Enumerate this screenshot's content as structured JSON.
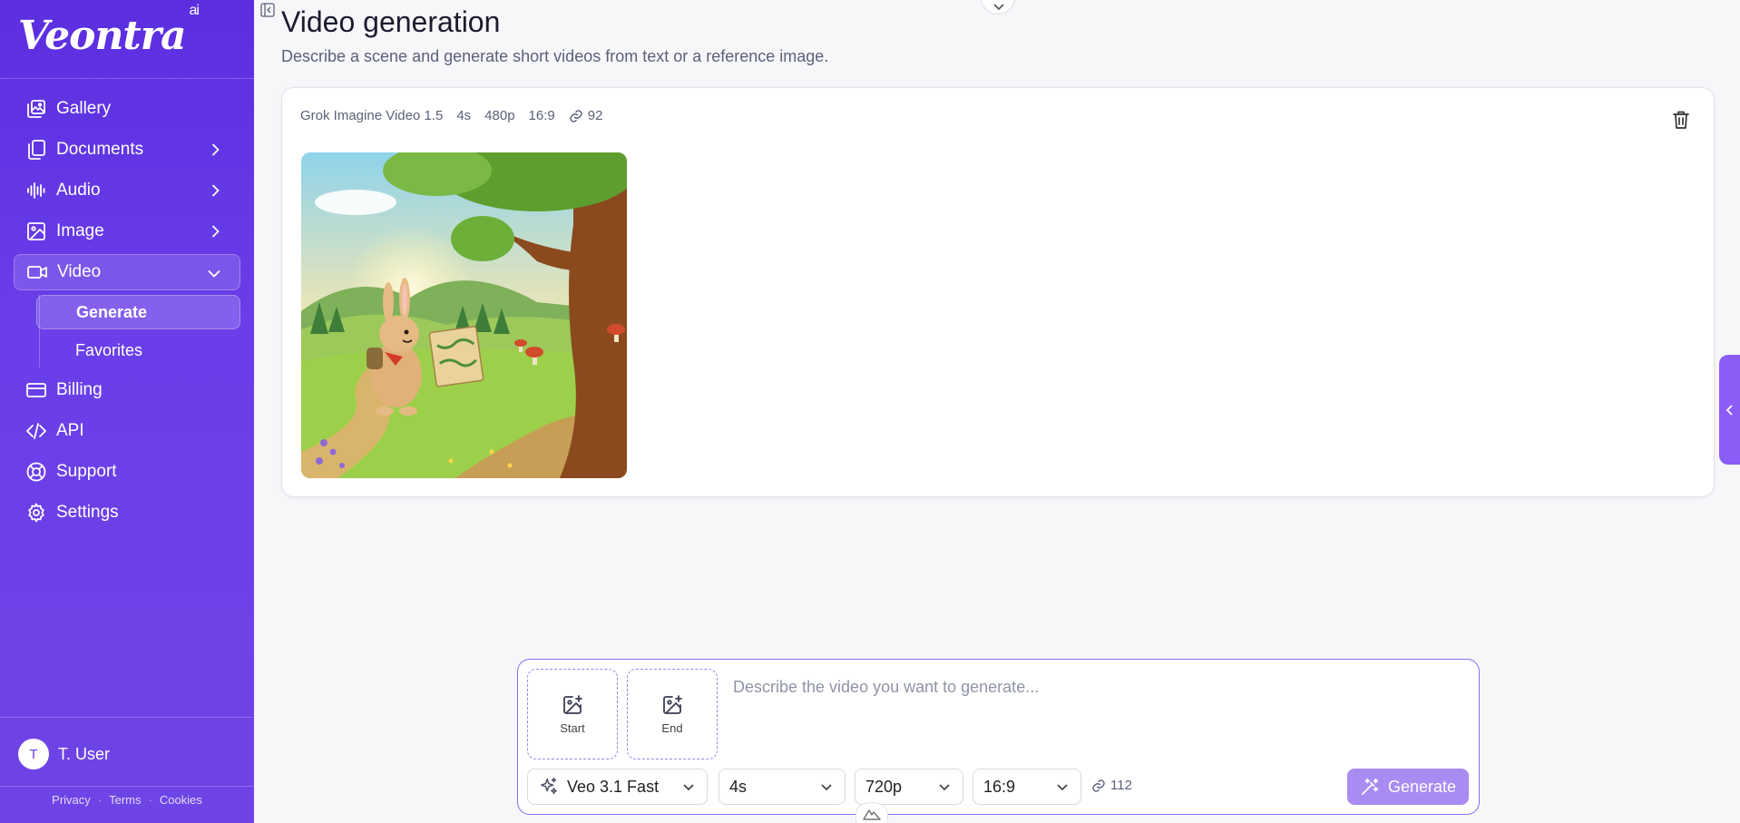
{
  "brand": {
    "name": "Veontra",
    "suffix": "ai"
  },
  "sidebar": {
    "items": [
      {
        "label": "Gallery",
        "icon": "gallery-icon"
      },
      {
        "label": "Documents",
        "icon": "documents-icon"
      },
      {
        "label": "Audio",
        "icon": "audio-wave-icon"
      },
      {
        "label": "Image",
        "icon": "image-icon"
      },
      {
        "label": "Video",
        "icon": "video-camera-icon",
        "expanded": true,
        "active": true
      },
      {
        "label": "Billing",
        "icon": "credit-card-icon"
      },
      {
        "label": "API",
        "icon": "code-icon"
      },
      {
        "label": "Support",
        "icon": "lifebuoy-icon"
      },
      {
        "label": "Settings",
        "icon": "gear-icon"
      }
    ],
    "video_sub": [
      {
        "label": "Generate",
        "active": true
      },
      {
        "label": "Favorites"
      }
    ],
    "user": {
      "initial": "T",
      "name": "T. User"
    },
    "footer": {
      "privacy": "Privacy",
      "terms": "Terms",
      "cookies": "Cookies",
      "sep": "·"
    }
  },
  "page": {
    "title": "Video generation",
    "subtitle": "Describe a scene and generate short videos from text or a reference image."
  },
  "result": {
    "model": "Grok Imagine Video 1.5",
    "duration": "4s",
    "resolution": "480p",
    "aspect": "16:9",
    "credits": "92"
  },
  "composer": {
    "start_label": "Start",
    "end_label": "End",
    "placeholder": "Describe the video you want to generate...",
    "model": "Veo 3.1 Fast",
    "duration": "4s",
    "resolution": "720p",
    "aspect": "16:9",
    "credits": "112",
    "generate_label": "Generate"
  },
  "colors": {
    "sidebar": "#5b2ee0",
    "accent": "#8b5cf6",
    "generate_button": "#a98bf2"
  }
}
